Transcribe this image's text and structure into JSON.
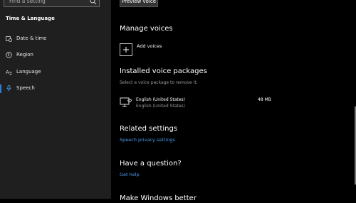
{
  "sidebar": {
    "search_placeholder": "Find a setting",
    "section_title": "Time & Language",
    "items": [
      {
        "label": "Date & time",
        "icon": "calendar-clock-icon"
      },
      {
        "label": "Region",
        "icon": "globe-icon"
      },
      {
        "label": "Language",
        "icon": "language-icon"
      },
      {
        "label": "Speech",
        "icon": "microphone-icon",
        "selected": true
      }
    ]
  },
  "main": {
    "preview_button": "Preview voice",
    "manage_title": "Manage voices",
    "add_voices_label": "Add voices",
    "installed_title": "Installed voice packages",
    "installed_subtitle": "Select a voice package to remove it.",
    "package": {
      "name": "English (United States)",
      "sub": "English (United States)",
      "size": "48 MB"
    },
    "related_title": "Related settings",
    "related_link": "Speech privacy settings",
    "question_title": "Have a question?",
    "help_link": "Get help",
    "bottom_partial_title": "Make Windows better"
  },
  "colors": {
    "accent": "#2d7de0",
    "link": "#4a9ef0"
  }
}
